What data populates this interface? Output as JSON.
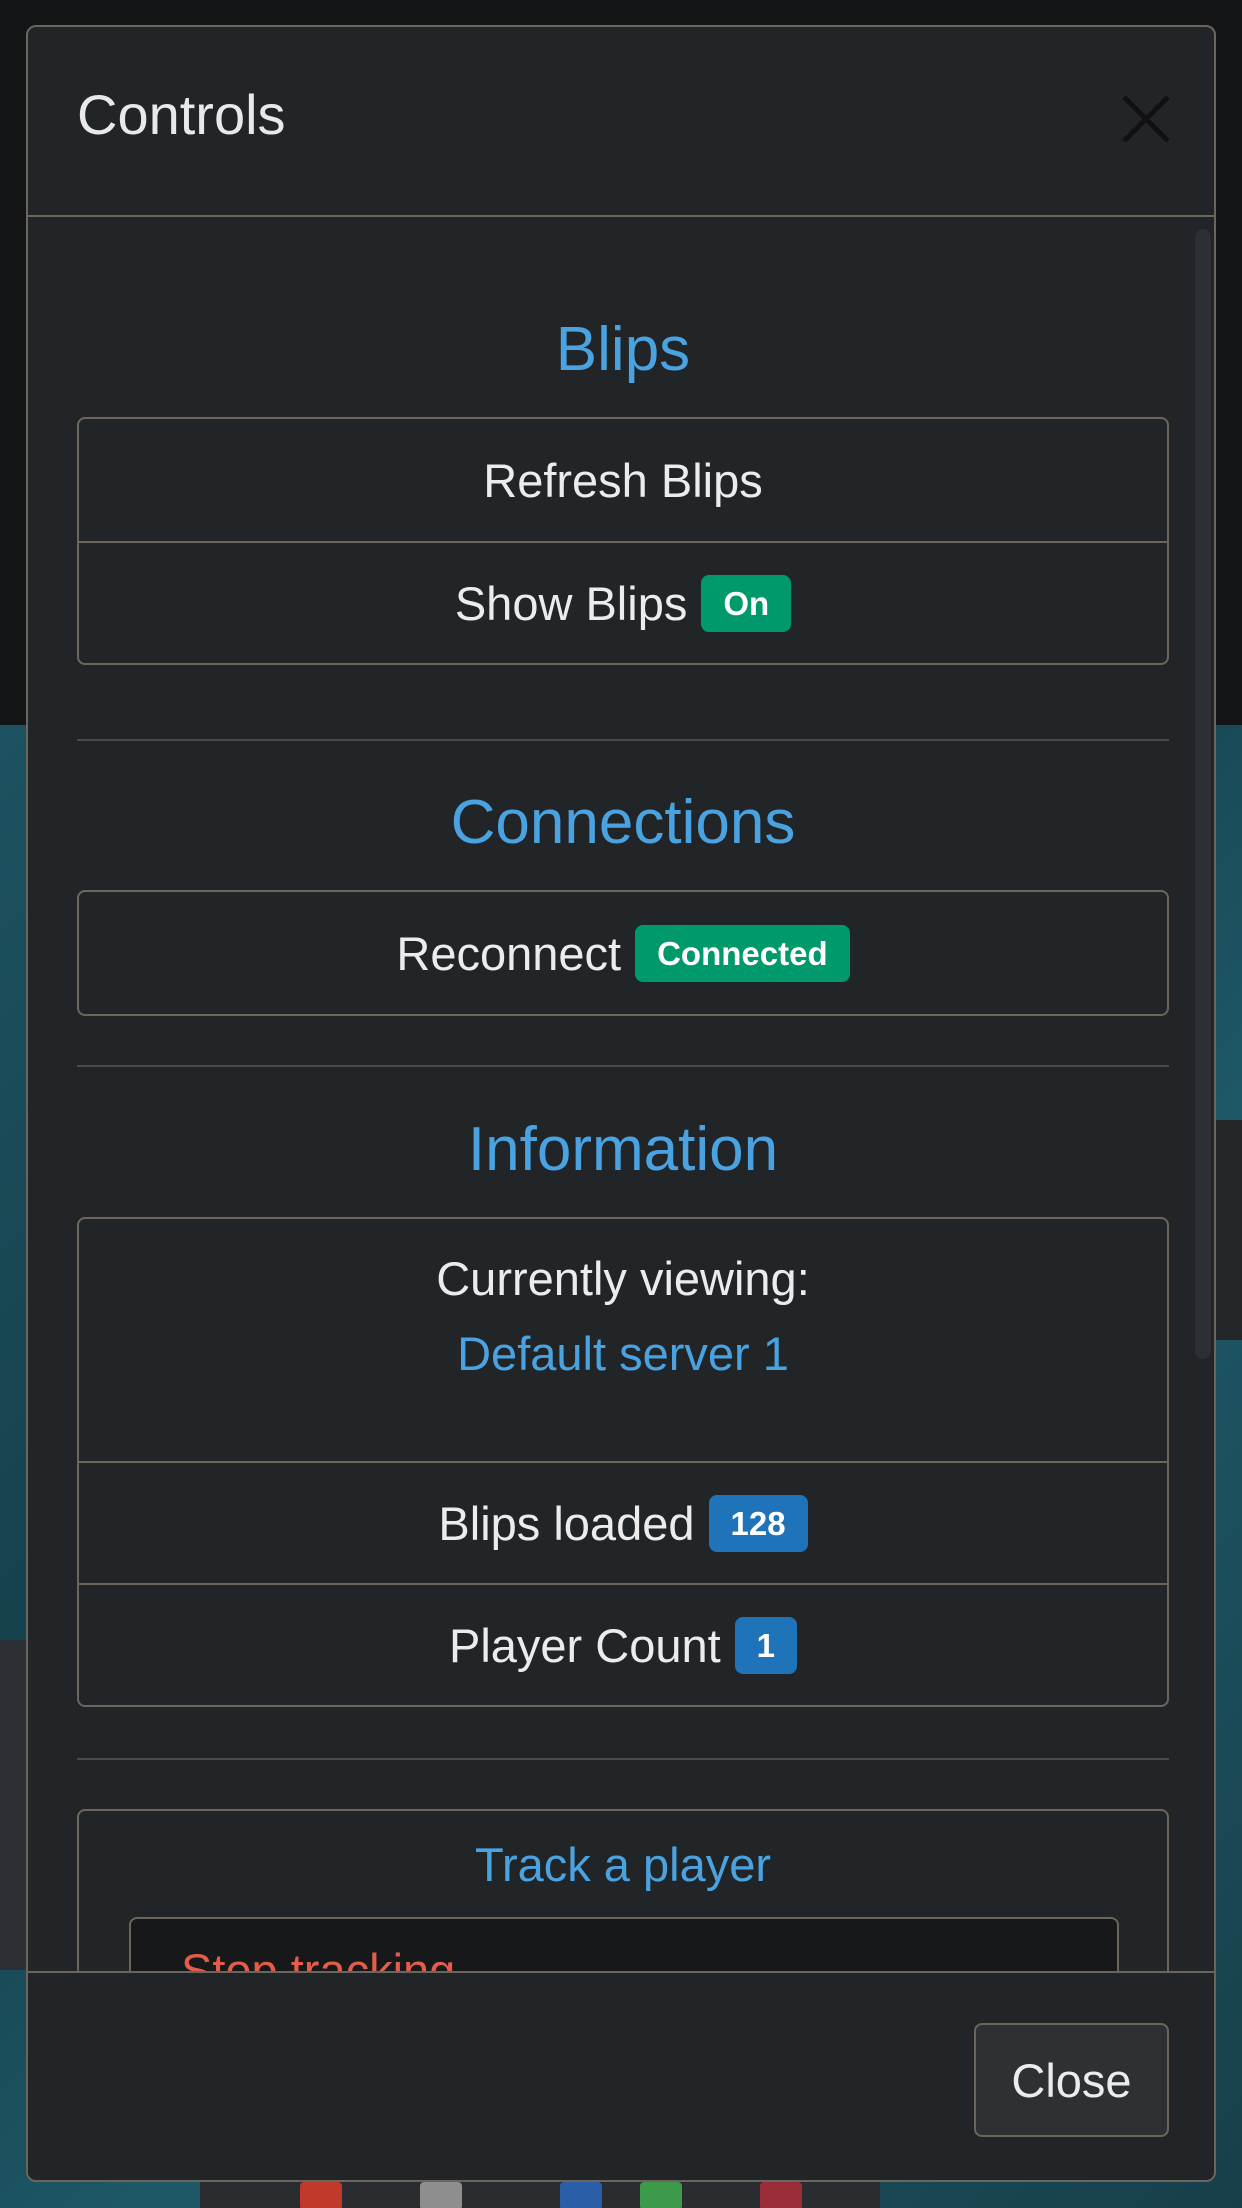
{
  "modal": {
    "title": "Controls",
    "close_icon": "close-icon",
    "footer_close_label": "Close"
  },
  "blips": {
    "title": "Blips",
    "refresh_label": "Refresh Blips",
    "show_label": "Show Blips",
    "show_badge": "On"
  },
  "connections": {
    "title": "Connections",
    "reconnect_label": "Reconnect",
    "status_badge": "Connected"
  },
  "information": {
    "title": "Information",
    "viewing_label": "Currently viewing:",
    "viewing_value": "Default server 1",
    "blips_loaded_label": "Blips loaded",
    "blips_loaded_count": "128",
    "player_count_label": "Player Count",
    "player_count_value": "1"
  },
  "tracking": {
    "title": "Track a player",
    "selected_option": "Stop tracking"
  },
  "colors": {
    "accent_blue": "#4aa3e0",
    "success_green": "#00996b",
    "badge_blue": "#1f74b9",
    "danger_red": "#e35d4a",
    "modal_bg": "#222528"
  }
}
